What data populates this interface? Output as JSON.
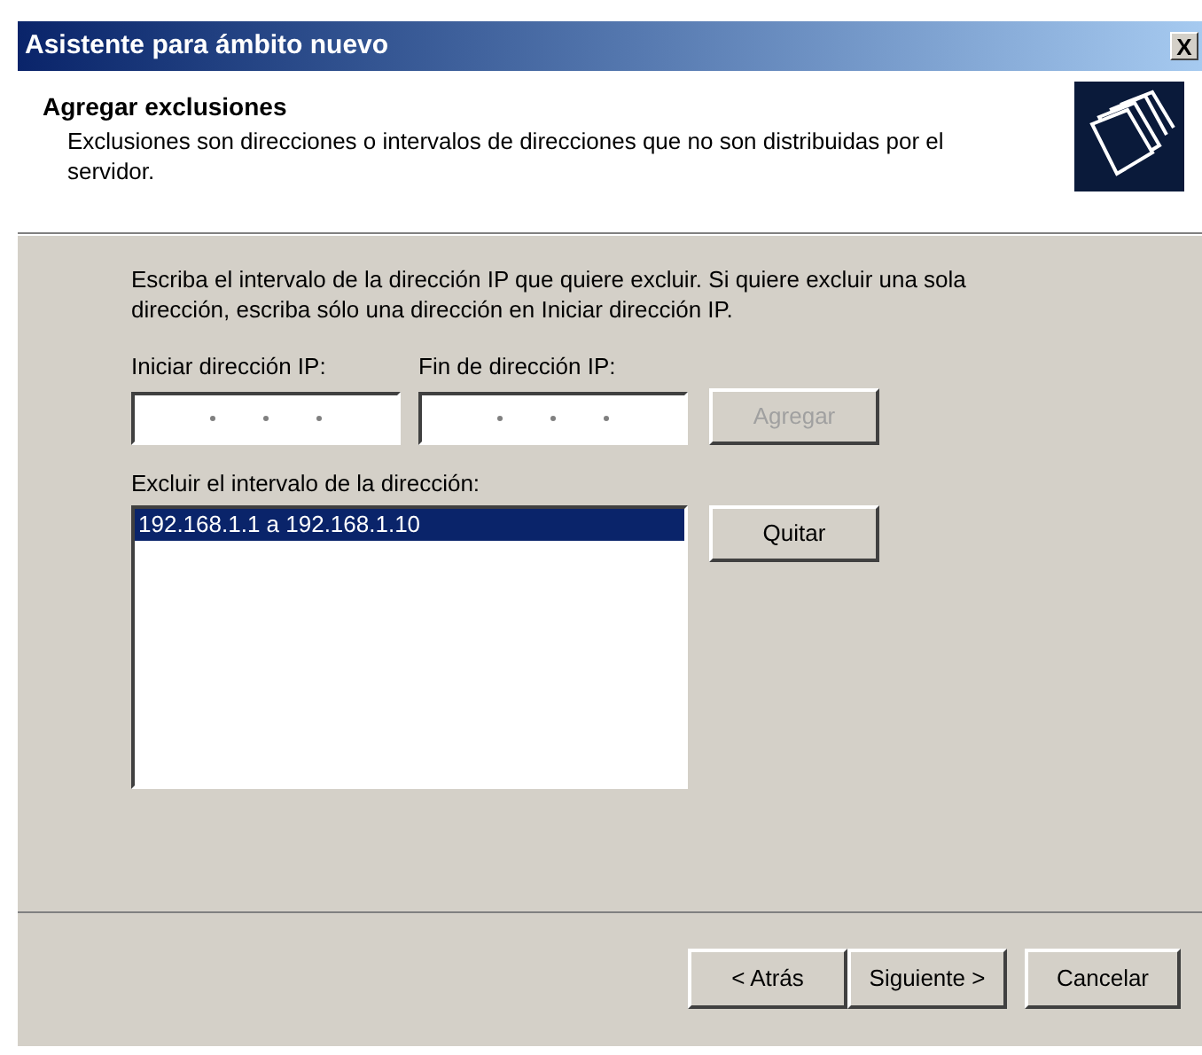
{
  "window": {
    "title": "Asistente para ámbito nuevo",
    "close": "X"
  },
  "header": {
    "title": "Agregar exclusiones",
    "description": "Exclusiones son direcciones o intervalos de direcciones que no son distribuidas por el servidor."
  },
  "instructions": "Escriba el intervalo de la dirección IP que quiere excluir. Si quiere excluir una sola dirección, escriba sólo una dirección en Iniciar dirección IP.",
  "start_ip": {
    "label": "Iniciar dirección IP:"
  },
  "end_ip": {
    "label": "Fin de dirección IP:"
  },
  "add_button": {
    "label": "Agregar",
    "disabled": true
  },
  "exclusions": {
    "label": "Excluir el intervalo de la dirección:",
    "items": [
      {
        "text": "192.168.1.1 a 192.168.1.10",
        "selected": true
      }
    ]
  },
  "remove_button": {
    "label": "Quitar",
    "disabled": false
  },
  "buttons": [
    {
      "label": "< Atrás"
    },
    {
      "label": "Siguiente >"
    },
    {
      "label": "Cancelar"
    }
  ]
}
